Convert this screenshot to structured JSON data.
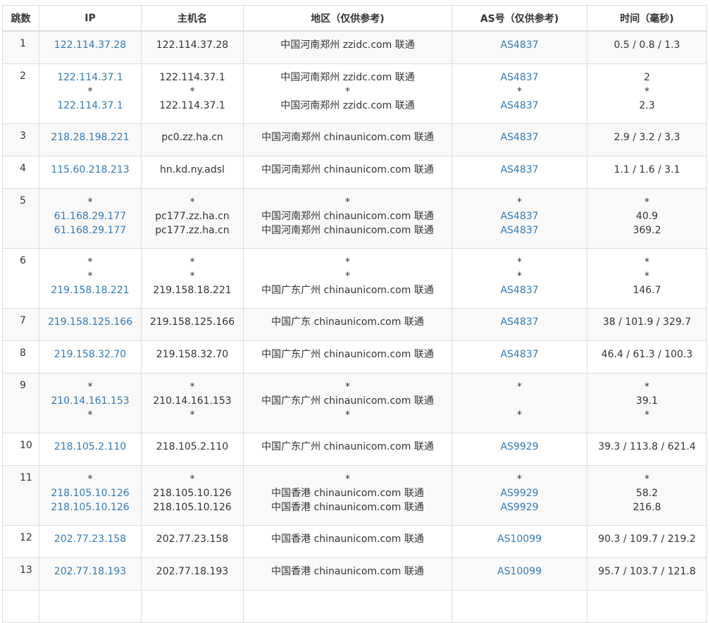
{
  "columns": {
    "hop": "跳数",
    "ip": "IP",
    "host": "主机名",
    "region": "地区（仅供参考)",
    "as": "AS号（仅供参考)",
    "time": "时间（毫秒)"
  },
  "rows": [
    {
      "hop": "1",
      "lines": [
        {
          "ip": "122.114.37.28",
          "host": "122.114.37.28",
          "region": "中国河南郑州 zzidc.com 联通",
          "as": "AS4837",
          "time": "0.5 / 0.8 / 1.3"
        }
      ]
    },
    {
      "hop": "2",
      "lines": [
        {
          "ip": "122.114.37.1",
          "host": "122.114.37.1",
          "region": "中国河南郑州 zzidc.com 联通",
          "as": "AS4837",
          "time": "2"
        },
        {
          "ip": "*",
          "host": "*",
          "region": "*",
          "as": "*",
          "time": "*"
        },
        {
          "ip": "122.114.37.1",
          "host": "122.114.37.1",
          "region": "中国河南郑州 zzidc.com 联通",
          "as": "AS4837",
          "time": "2.3"
        }
      ]
    },
    {
      "hop": "3",
      "lines": [
        {
          "ip": "218.28.198.221",
          "host": "pc0.zz.ha.cn",
          "region": "中国河南郑州 chinaunicom.com 联通",
          "as": "AS4837",
          "time": "2.9 / 3.2 / 3.3"
        }
      ]
    },
    {
      "hop": "4",
      "lines": [
        {
          "ip": "115.60.218.213",
          "host": "hn.kd.ny.adsl",
          "region": "中国河南郑州 chinaunicom.com 联通",
          "as": "AS4837",
          "time": "1.1 / 1.6 / 3.1"
        }
      ]
    },
    {
      "hop": "5",
      "lines": [
        {
          "ip": "*",
          "host": "*",
          "region": "*",
          "as": "*",
          "time": "*"
        },
        {
          "ip": "61.168.29.177",
          "host": "pc177.zz.ha.cn",
          "region": "中国河南郑州 chinaunicom.com 联通",
          "as": "AS4837",
          "time": "40.9"
        },
        {
          "ip": "61.168.29.177",
          "host": "pc177.zz.ha.cn",
          "region": "中国河南郑州 chinaunicom.com 联通",
          "as": "AS4837",
          "time": "369.2"
        }
      ]
    },
    {
      "hop": "6",
      "lines": [
        {
          "ip": "*",
          "host": "*",
          "region": "*",
          "as": "*",
          "time": "*"
        },
        {
          "ip": "*",
          "host": "*",
          "region": "*",
          "as": "*",
          "time": "*"
        },
        {
          "ip": "219.158.18.221",
          "host": "219.158.18.221",
          "region": "中国广东广州 chinaunicom.com 联通",
          "as": "AS4837",
          "time": "146.7"
        }
      ]
    },
    {
      "hop": "7",
      "lines": [
        {
          "ip": "219.158.125.166",
          "host": "219.158.125.166",
          "region": "中国广东 chinaunicom.com 联通",
          "as": "AS4837",
          "time": "38 / 101.9 / 329.7"
        }
      ]
    },
    {
      "hop": "8",
      "lines": [
        {
          "ip": "219.158.32.70",
          "host": "219.158.32.70",
          "region": "中国广东广州 chinaunicom.com 联通",
          "as": "AS4837",
          "time": "46.4 / 61.3 / 100.3"
        }
      ]
    },
    {
      "hop": "9",
      "lines": [
        {
          "ip": "*",
          "host": "*",
          "region": "*",
          "as": "*",
          "time": "*"
        },
        {
          "ip": "210.14.161.153",
          "host": "210.14.161.153",
          "region": "中国广东广州 chinaunicom.com 联通",
          "as": "",
          "time": "39.1"
        },
        {
          "ip": "*",
          "host": "*",
          "region": "*",
          "as": "*",
          "time": "*"
        }
      ]
    },
    {
      "hop": "10",
      "lines": [
        {
          "ip": "218.105.2.110",
          "host": "218.105.2.110",
          "region": "中国广东广州 chinaunicom.com 联通",
          "as": "AS9929",
          "time": "39.3 / 113.8 / 621.4"
        }
      ]
    },
    {
      "hop": "11",
      "lines": [
        {
          "ip": "*",
          "host": "*",
          "region": "*",
          "as": "*",
          "time": "*"
        },
        {
          "ip": "218.105.10.126",
          "host": "218.105.10.126",
          "region": "中国香港 chinaunicom.com 联通",
          "as": "AS9929",
          "time": "58.2"
        },
        {
          "ip": "218.105.10.126",
          "host": "218.105.10.126",
          "region": "中国香港 chinaunicom.com 联通",
          "as": "AS9929",
          "time": "216.8"
        }
      ]
    },
    {
      "hop": "12",
      "lines": [
        {
          "ip": "202.77.23.158",
          "host": "202.77.23.158",
          "region": "中国香港 chinaunicom.com 联通",
          "as": "AS10099",
          "time": "90.3 / 109.7 / 219.2"
        }
      ]
    },
    {
      "hop": "13",
      "lines": [
        {
          "ip": "202.77.18.193",
          "host": "202.77.18.193",
          "region": "中国香港 chinaunicom.com 联通",
          "as": "AS10099",
          "time": "95.7 / 103.7 / 121.8"
        }
      ]
    },
    {
      "hop": "",
      "lines": [
        {
          "ip": "",
          "host": "",
          "region": "",
          "as": "",
          "time": ""
        }
      ]
    }
  ],
  "colors": {
    "link": "#337ab7",
    "text": "#333333",
    "border": "#dddddd",
    "stripe": "#f9f9f9"
  }
}
